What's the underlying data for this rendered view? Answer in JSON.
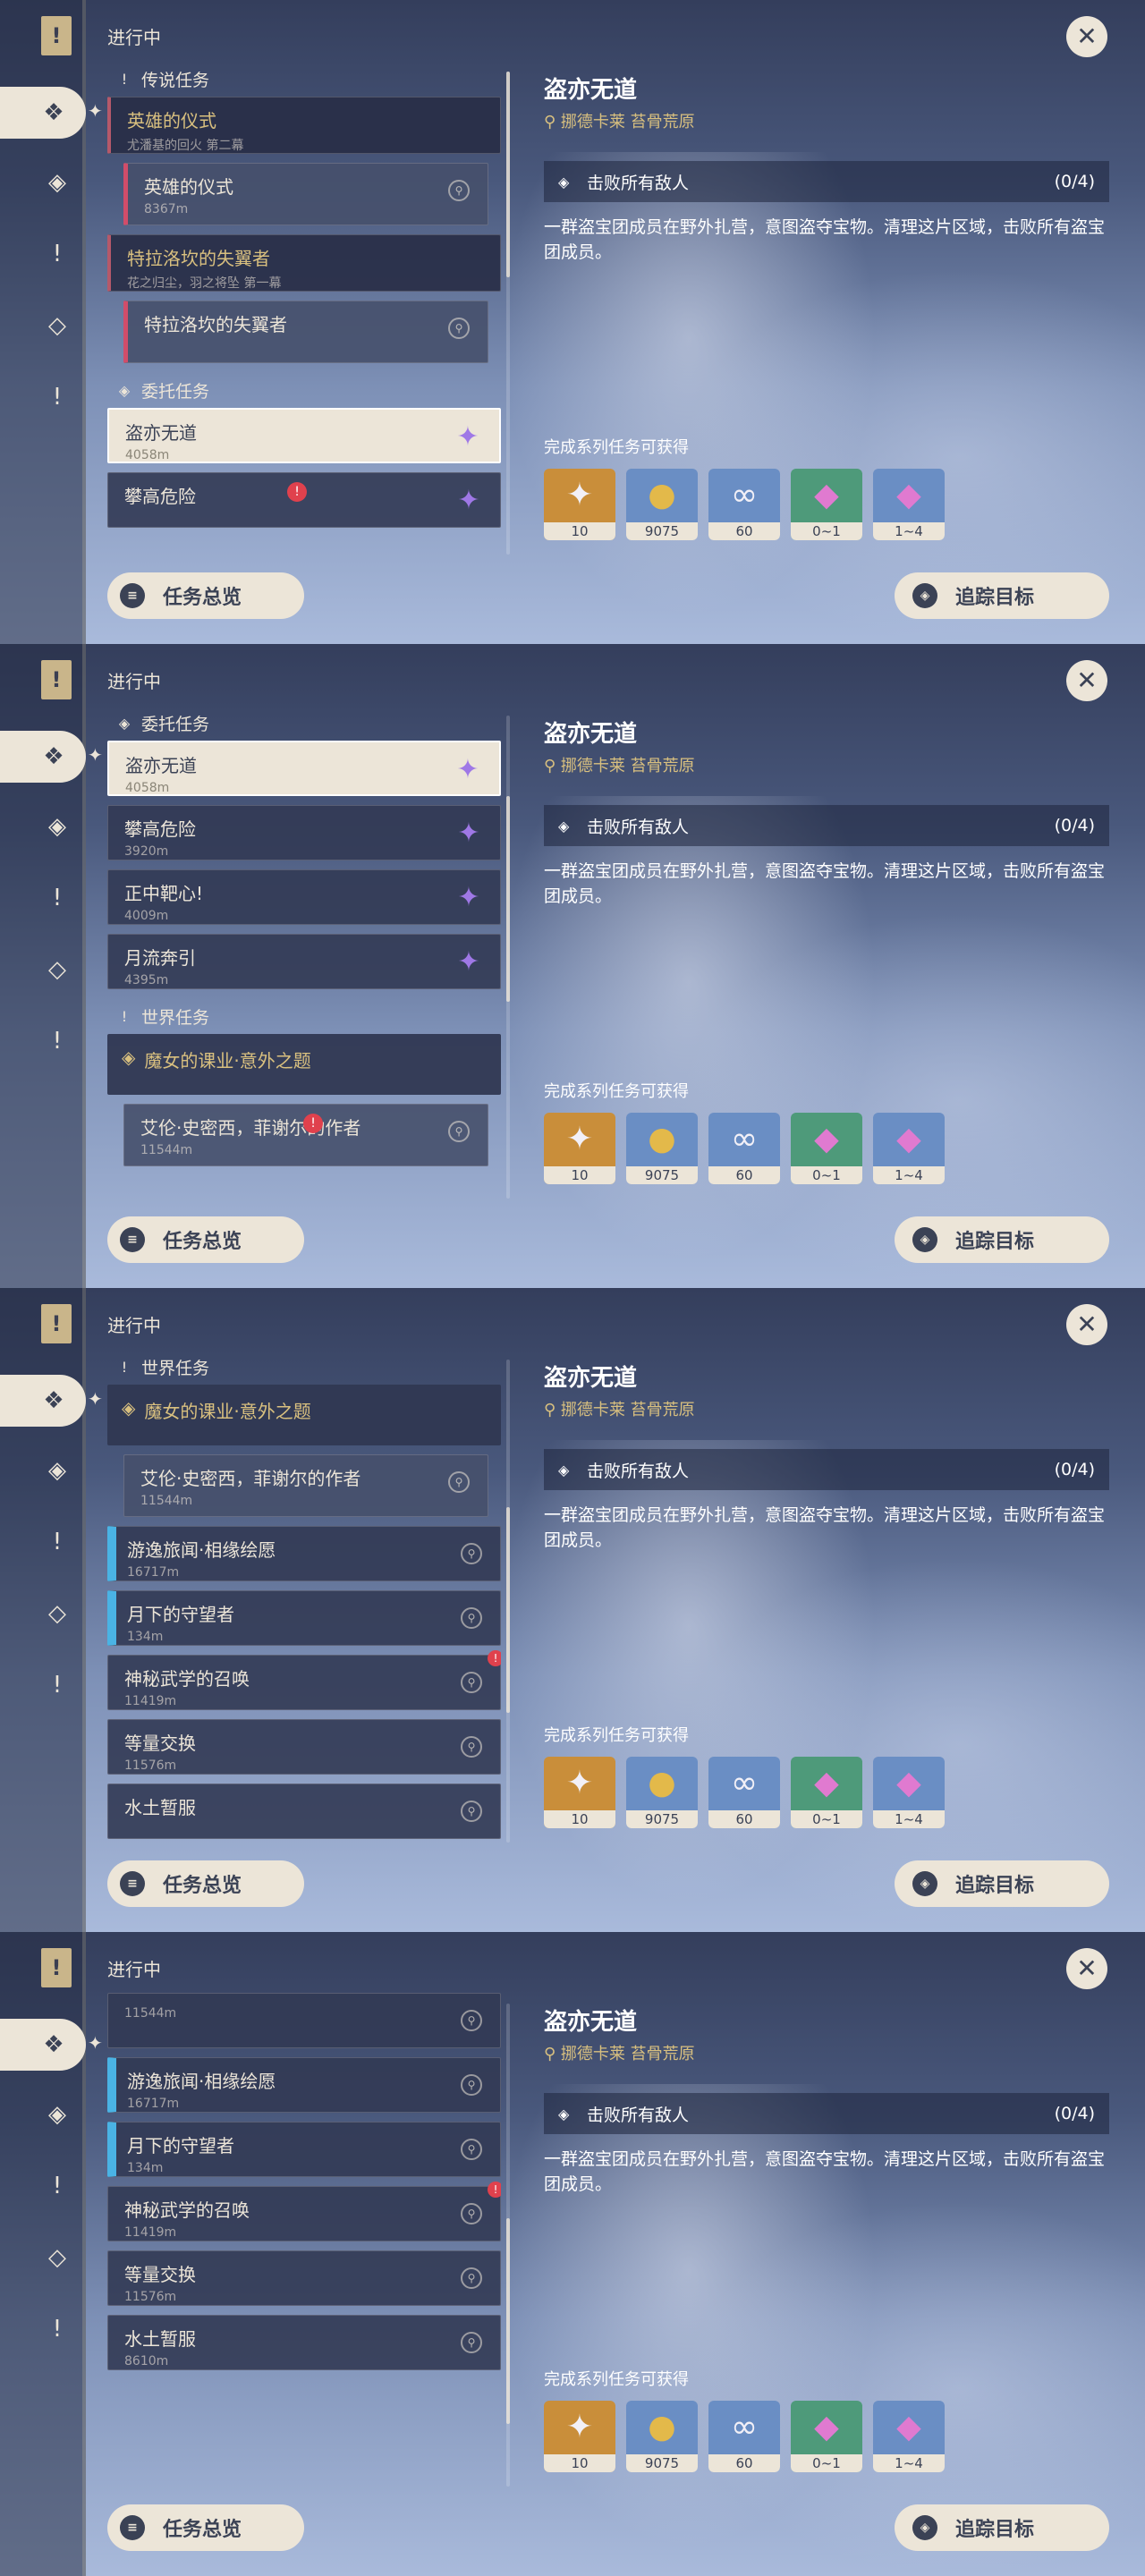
{
  "header": {
    "status": "进行中"
  },
  "detail": {
    "title": "盗亦无道",
    "location": "挪德卡莱 苔骨荒原",
    "objective": "击败所有敌人",
    "objective_count": "(0/4)",
    "description": "一群盗宝团成员在野外扎营，意图盗夺宝物。清理这片区域，击败所有盗宝团成员。",
    "rewards_label": "完成系列任务可获得",
    "rewards": [
      {
        "name": "primogem",
        "count": "10",
        "color": "#c98e3a",
        "glyph": "✦"
      },
      {
        "name": "mora",
        "count": "9075",
        "color": "#6a8ec4",
        "glyph": "●"
      },
      {
        "name": "companionship-exp",
        "count": "60",
        "color": "#6a8ec4",
        "glyph": "∞"
      },
      {
        "name": "green-crystal",
        "count": "0~1",
        "color": "#4e9a7a",
        "glyph": "◆"
      },
      {
        "name": "purple-crystal",
        "count": "1~4",
        "color": "#6a8ec4",
        "glyph": "◆"
      }
    ]
  },
  "buttons": {
    "overview": "任务总览",
    "track": "追踪目标"
  },
  "sections": {
    "legend": "传说任务",
    "commission": "委托任务",
    "world": "世界任务"
  },
  "panels": [
    {
      "thumb": 0.0,
      "rows": [
        {
          "kind": "sec",
          "icon": "!",
          "label": "传说任务"
        },
        {
          "kind": "group",
          "title": "英雄的仪式",
          "sub": "尤潘基的回火 第二幕"
        },
        {
          "kind": "sub",
          "title": "英雄的仪式",
          "sub": "8367m"
        },
        {
          "kind": "group",
          "title": "特拉洛坎的失翼者",
          "sub": "花之归尘，羽之将坠 第一幕"
        },
        {
          "kind": "sub",
          "title": "特拉洛坎的失翼者",
          "sub": ""
        },
        {
          "kind": "sec",
          "icon": "◈",
          "label": "委托任务"
        },
        {
          "kind": "sel",
          "title": "盗亦无道",
          "sub": "4058m"
        },
        {
          "kind": "gem",
          "title": "攀高危险",
          "sub": "",
          "warn": true
        }
      ]
    },
    {
      "thumb": 0.3,
      "rows": [
        {
          "kind": "sec",
          "icon": "◈",
          "label": "委托任务"
        },
        {
          "kind": "sel",
          "title": "盗亦无道",
          "sub": "4058m"
        },
        {
          "kind": "gem",
          "title": "攀高危险",
          "sub": "3920m"
        },
        {
          "kind": "gem",
          "title": "正中靶心!",
          "sub": "4009m"
        },
        {
          "kind": "gem",
          "title": "月流奔引",
          "sub": "4395m"
        },
        {
          "kind": "sec",
          "icon": "!",
          "label": "世界任务"
        },
        {
          "kind": "chapter",
          "title": "魔女的课业·意外之题"
        },
        {
          "kind": "sub2",
          "title": "艾伦·史密西，菲谢尔的作者",
          "sub": "11544m",
          "warn": true
        }
      ]
    },
    {
      "thumb": 0.55,
      "rows": [
        {
          "kind": "sec",
          "icon": "!",
          "label": "世界任务"
        },
        {
          "kind": "chapter",
          "title": "魔女的课业·意外之题"
        },
        {
          "kind": "sub2",
          "title": "艾伦·史密西，菲谢尔的作者",
          "sub": "11544m"
        },
        {
          "kind": "blue",
          "title": "游逸旅闻·相缘绘愿",
          "sub": "16717m"
        },
        {
          "kind": "blue",
          "title": "月下的守望者",
          "sub": "134m"
        },
        {
          "kind": "pin",
          "title": "神秘武学的召唤",
          "sub": "11419m",
          "warnr": true
        },
        {
          "kind": "pin",
          "title": "等量交换",
          "sub": "11576m"
        },
        {
          "kind": "pin",
          "title": "水土暂服",
          "sub": ""
        }
      ]
    },
    {
      "thumb": 0.8,
      "rows": [
        {
          "kind": "pin",
          "title": "",
          "sub": "11544m"
        },
        {
          "kind": "blue",
          "title": "游逸旅闻·相缘绘愿",
          "sub": "16717m"
        },
        {
          "kind": "blue",
          "title": "月下的守望者",
          "sub": "134m"
        },
        {
          "kind": "pin",
          "title": "神秘武学的召唤",
          "sub": "11419m",
          "warnr": true
        },
        {
          "kind": "pin",
          "title": "等量交换",
          "sub": "11576m"
        },
        {
          "kind": "pin",
          "title": "水土暂服",
          "sub": "8610m"
        }
      ]
    }
  ]
}
